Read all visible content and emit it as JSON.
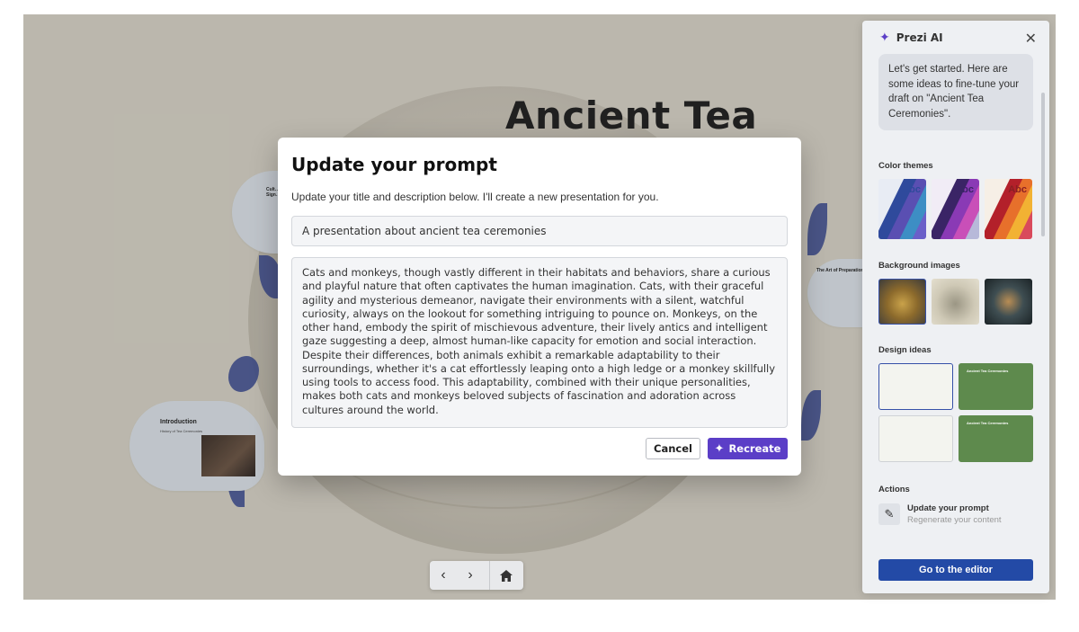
{
  "canvas": {
    "presentation_title": "Ancient Tea",
    "intro_bubble_title": "Introduction",
    "intro_bubble_sub": "History of Tea Ceremonies",
    "cult_bubble_title": "Cult… Sign…",
    "art_bubble_title": "The Art of Preparation"
  },
  "modal": {
    "title": "Update your prompt",
    "description": "Update your title and description below. I'll create a new presentation for you.",
    "title_value": "A presentation about ancient tea ceremonies",
    "body_value": "Cats and monkeys, though vastly different in their habitats and behaviors, share a curious and playful nature that often captivates the human imagination. Cats, with their graceful agility and mysterious demeanor, navigate their environments with a silent, watchful curiosity, always on the lookout for something intriguing to pounce on. Monkeys, on the other hand, embody the spirit of mischievous adventure, their lively antics and intelligent gaze suggesting a deep, almost human-like capacity for emotion and social interaction. Despite their differences, both animals exhibit a remarkable adaptability to their surroundings, whether it's a cat effortlessly leaping onto a high ledge or a monkey skillfully using tools to access food. This adaptability, combined with their unique personalities, makes both cats and monkeys beloved subjects of fascination and adoration across cultures around the world.",
    "cancel_label": "Cancel",
    "recreate_label": "Recreate"
  },
  "panel": {
    "title": "Prezi AI",
    "message": "Let's get started. Here are some ideas to fine-tune your draft on \"Ancient Tea Ceremonies\".",
    "color_themes_label": "Color themes",
    "theme_text": "Abc",
    "background_images_label": "Background images",
    "design_ideas_label": "Design ideas",
    "design_thumb_title": "Ancient Tea Ceremonies",
    "actions_label": "Actions",
    "action_title": "Update your prompt",
    "action_sub": "Regenerate your content",
    "editor_button": "Go to the editor",
    "accent": "#5b3ec7",
    "primary": "#234aa6"
  },
  "nav": {
    "prev_icon": "chevron-left-icon",
    "next_icon": "chevron-right-icon",
    "home_icon": "home-icon"
  }
}
